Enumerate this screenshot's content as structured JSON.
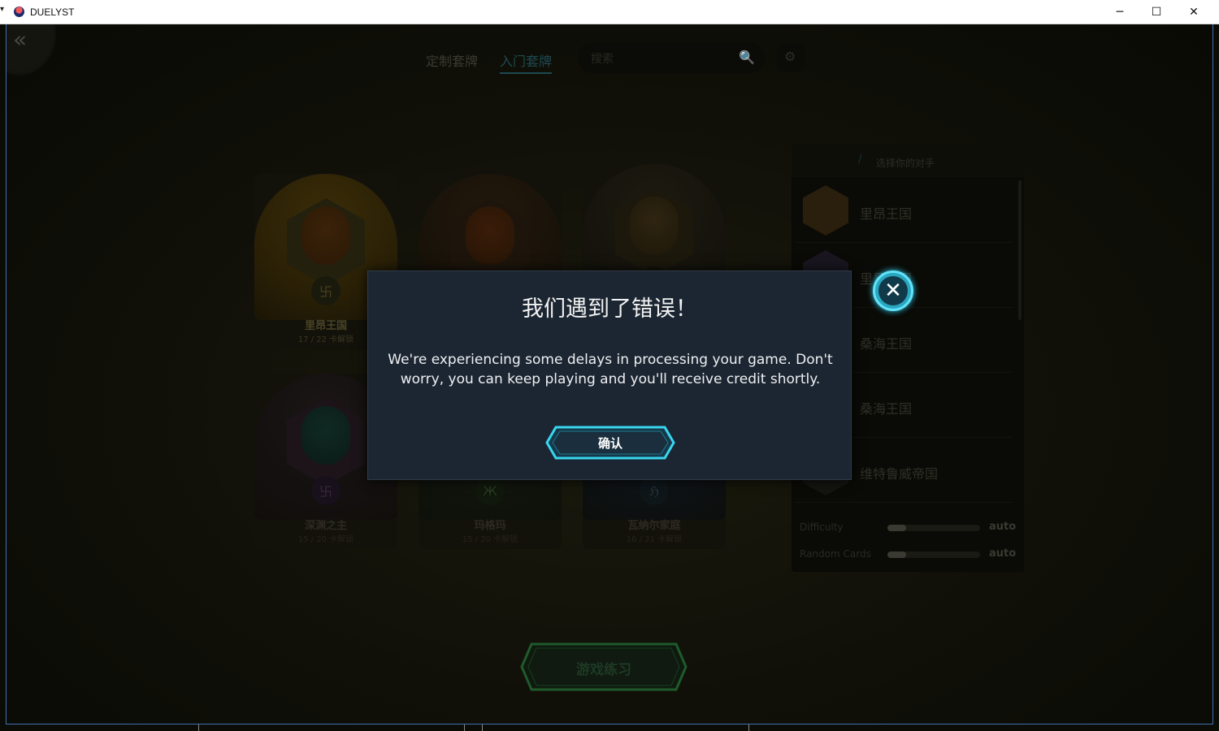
{
  "window": {
    "title": "DUELYST",
    "sys_menu": "▾",
    "minimize_glyph": "─",
    "maximize_glyph": "☐",
    "close_glyph": "✕"
  },
  "nav": {
    "back_glyph": "«"
  },
  "tabs": [
    {
      "label": "定制套牌"
    },
    {
      "label": "入门套牌"
    }
  ],
  "search": {
    "placeholder": "搜索",
    "icon_glyph": "🔍"
  },
  "settings": {
    "icon_glyph": "⚙"
  },
  "decks": [
    {
      "name": "里昂王国",
      "progress": "17 / 22 卡解锁",
      "emblem": "卐"
    },
    {
      "name": "",
      "progress": "",
      "emblem": ""
    },
    {
      "name": "",
      "progress": "",
      "emblem": ""
    },
    {
      "name": "深渊之主",
      "progress": "15 / 20 卡解锁",
      "emblem": "卐"
    },
    {
      "name": "玛格玛",
      "progress": "15 / 20 卡解锁",
      "emblem": "Ж"
    },
    {
      "name": "瓦纳尔家庭",
      "progress": "16 / 21 卡解锁",
      "emblem": "ℌ"
    }
  ],
  "opponents": {
    "header": "选择你的对手",
    "header_icon": "/",
    "items": [
      {
        "name": "里昂王国"
      },
      {
        "name": "里昂王国"
      },
      {
        "name": "桑海王国"
      },
      {
        "name": "桑海王国"
      },
      {
        "name": "维特鲁威帝国"
      }
    ],
    "difficulty": {
      "label": "Difficulty",
      "value": "auto",
      "level": 0.2
    },
    "random_cards": {
      "label": "Random Cards",
      "value": "auto",
      "level": 0.2
    }
  },
  "practice_button": {
    "label": "游戏练习"
  },
  "modal": {
    "title": "我们遇到了错误！",
    "message": "We're experiencing some delays in processing your game. Don't worry, you can keep playing and you'll receive credit shortly.",
    "confirm_label": "确认",
    "close_glyph": "✕"
  },
  "colors": {
    "modal_bg": "#1c2632",
    "accent_cyan": "#2fd0f0",
    "practice_green": "#1f5a2c"
  }
}
